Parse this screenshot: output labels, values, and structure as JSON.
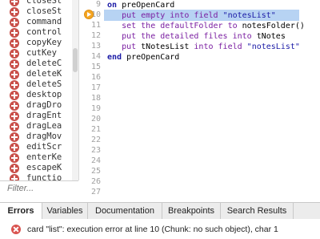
{
  "handlers": [
    {
      "label": "closeSt"
    },
    {
      "label": "closeSt"
    },
    {
      "label": "command"
    },
    {
      "label": "control"
    },
    {
      "label": "copyKey"
    },
    {
      "label": "cutKey"
    },
    {
      "label": "deleteC"
    },
    {
      "label": "deleteK"
    },
    {
      "label": "deleteS"
    },
    {
      "label": "desktop"
    },
    {
      "label": "dragDro"
    },
    {
      "label": "dragEnt"
    },
    {
      "label": "dragLea"
    },
    {
      "label": "dragMov"
    },
    {
      "label": "editScr"
    },
    {
      "label": "enterKe"
    },
    {
      "label": "escapeK"
    },
    {
      "label": "functio"
    }
  ],
  "filter": {
    "placeholder": "Filter..."
  },
  "line_numbers": [
    "9",
    "10",
    "11",
    "12",
    "13",
    "14",
    "15",
    "16",
    "17",
    "18",
    "19",
    "20",
    "21",
    "22",
    "23",
    "24",
    "25",
    "26",
    "27"
  ],
  "code": {
    "l9": {
      "kw": "on",
      "rest": "preOpenCard"
    },
    "l10": {
      "cmd": "put",
      "a": "empty",
      "b": "into",
      "c": "field",
      "str": "\"notesList\""
    },
    "l11": {
      "cmd": "set",
      "a": "the",
      "b": "defaultFolder",
      "c": "to",
      "rest": "notesFolder()"
    },
    "l12": {
      "cmd": "put",
      "a": "the",
      "b": "detailed",
      "c": "files",
      "d": "into",
      "rest": "tNotes"
    },
    "l13": {
      "cmd": "put",
      "a": "tNotesList",
      "b": "into",
      "c": "field",
      "str": "\"notesList\""
    },
    "l14": {
      "kw": "end",
      "rest": "preOpenCard"
    }
  },
  "tabs": [
    {
      "label": "Errors",
      "active": true
    },
    {
      "label": "Variables",
      "active": false
    },
    {
      "label": "Documentation",
      "active": false
    },
    {
      "label": "Breakpoints",
      "active": false
    },
    {
      "label": "Search Results",
      "active": false
    }
  ],
  "error": {
    "message": "card \"list\": execution error at line 10 (Chunk: no such object), char 1"
  },
  "colors": {
    "highlight": "#b7d3f3",
    "breakpoint": "#f5a623",
    "error": "#d9534f",
    "keyword": "#1a1aa6",
    "command": "#7a1ea1"
  }
}
